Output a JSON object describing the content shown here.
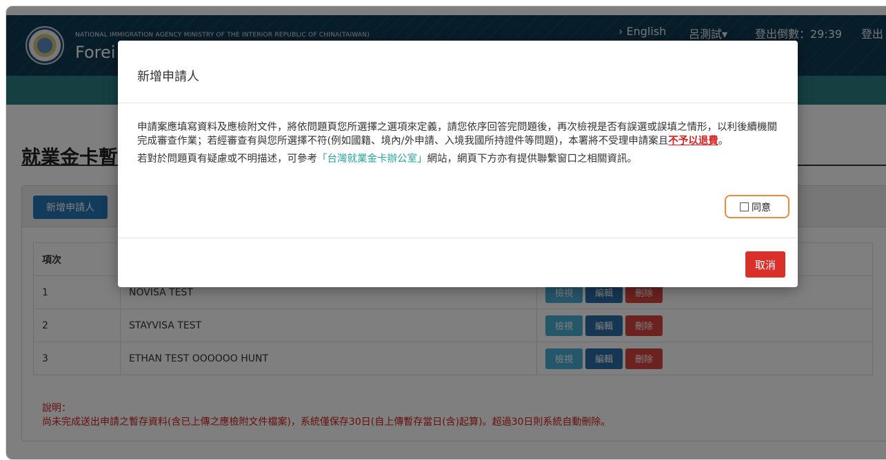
{
  "header": {
    "agency_text": "NATIONAL IMMIGRATION AGENCY MINISTRY OF THE INTERIOR REPUBLIC OF CHINA(TAIWAN)",
    "brand_text": "Forei",
    "lang_link": "› English",
    "user_menu": "呂測試▾",
    "logout_timer": "登出倒數：29:39",
    "logout_link": "登出"
  },
  "page": {
    "title": "就業金卡暫",
    "add_button": "新增申請人",
    "table": {
      "headers": [
        "項次",
        "",
        ""
      ],
      "rows": [
        {
          "index": "1",
          "name": "NOVISA TEST"
        },
        {
          "index": "2",
          "name": "STAYVISA TEST"
        },
        {
          "index": "3",
          "name": "ETHAN TEST OOOOOO HUNT"
        }
      ],
      "actions": {
        "view": "檢視",
        "edit": "編輯",
        "delete": "刪除"
      }
    },
    "note_label": "說明：",
    "note_text": "尚未完成送出申請之暫存資料(含已上傳之應檢附文件檔案)，系統僅保存30日(自上傳暫存當日(含)起算)。超過30日則系統自動刪除。"
  },
  "modal": {
    "title": "新增申請人",
    "para1_a": "申請案應填寫資料及應檢附文件，將依問題頁您所選擇之選項來定義，請您依序回答完問題後，再次檢視是否有誤選或誤填之情形，以利後續機關完成審查作業；若經審查有與您所選擇不符(例如國籍、境內/外申請、入境我國所持證件等問題)，本署將不受理申請案且",
    "para1_red": "不予以退費",
    "para1_end": "。",
    "para2_a": "若對於問題頁有疑慮或不明描述，可參考",
    "para2_link": "「台灣就業金卡辦公室」",
    "para2_b": "網站，網頁下方亦有提供聯繫窗口之相關資訊。",
    "agree_label": "同意",
    "cancel_button": "取消"
  }
}
